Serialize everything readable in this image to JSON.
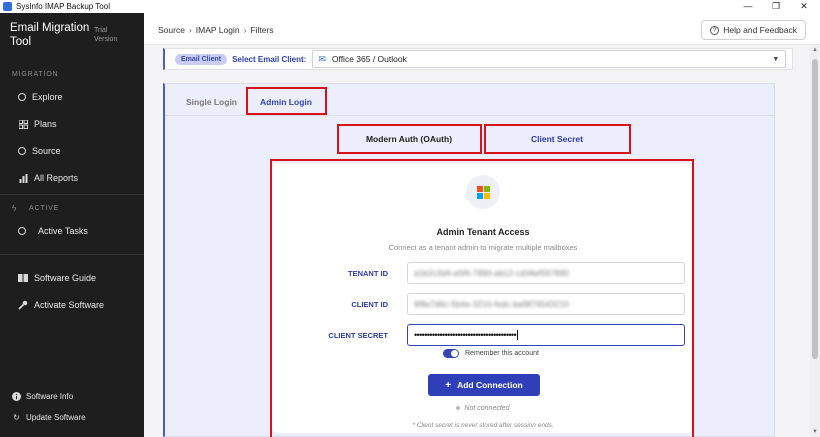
{
  "window": {
    "title": "SysInfo IMAP Backup Tool",
    "controls": {
      "minimize": "—",
      "maximize": "❐",
      "close": "✕"
    }
  },
  "sidebar": {
    "brand": "Email Migration Tool",
    "brand_tag": "Trial Version",
    "sections": {
      "migration": "MIGRATION",
      "active": "ACTIVE"
    },
    "items": {
      "explore": "Explore",
      "plans": "Plans",
      "source": "Source",
      "all_reports": "All Reports",
      "active_tasks": "Active Tasks",
      "software_guide": "Software Guide",
      "activate_software": "Activate Software"
    },
    "bottom": {
      "software_info": "Software Info",
      "update_software": "Update Software"
    }
  },
  "header": {
    "breadcrumb": [
      "Source",
      "IMAP Login",
      "Filters"
    ],
    "breadcrumb_sep": "›",
    "help_label": "Help and Feedback"
  },
  "client": {
    "pill": "Email Client",
    "label": "Select Email Client:",
    "selected": "Office 365 / Outlook"
  },
  "tabs": {
    "single": "Single Login",
    "admin": "Admin Login"
  },
  "modes": {
    "modern": "Modern Auth (OAuth)",
    "secret": "Client Secret"
  },
  "form": {
    "title": "Admin Tenant Access",
    "subtitle": "Connect as a tenant admin to migrate multiple mailboxes",
    "tenant_label": "TENANT ID",
    "tenant_value": "a1b2c3d4-e5f6-7890-ab12-cd34ef567890",
    "client_label": "CLIENT ID",
    "client_value": "9f8e7d6c-5b4a-3210-fedc-ba9876543210",
    "secret_label": "CLIENT SECRET",
    "secret_value": "••••••••••••••••••••••••••••••••••••••••",
    "remember": "Remember this account",
    "remember_on": true,
    "add_button": "Add Connection",
    "status": "Not connected",
    "footnote": "* Client secret is never stored after session ends."
  },
  "colors": {
    "accent": "#3344b5",
    "highlight_box": "#d8121b",
    "sidebar_bg": "#1e1e1e"
  }
}
